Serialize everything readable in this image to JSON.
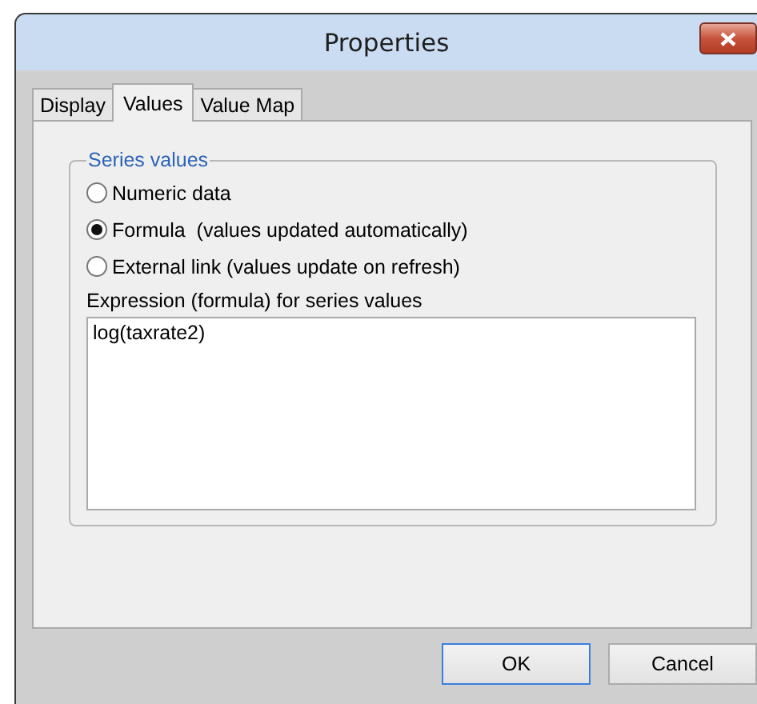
{
  "window": {
    "title": "Properties"
  },
  "tabs": [
    {
      "label": "Display",
      "selected": false
    },
    {
      "label": "Values",
      "selected": true
    },
    {
      "label": "Value Map",
      "selected": false
    }
  ],
  "series_values": {
    "legend": "Series values",
    "options": [
      {
        "label": "Numeric data",
        "selected": false
      },
      {
        "label": "Formula  (values updated automatically)",
        "selected": true
      },
      {
        "label": "External link (values update on refresh)",
        "selected": false
      }
    ],
    "expression_label": "Expression (formula) for series values",
    "expression": "log(taxrate2)"
  },
  "buttons": [
    {
      "label": "OK",
      "default": true
    },
    {
      "label": "Cancel",
      "default": false
    }
  ]
}
